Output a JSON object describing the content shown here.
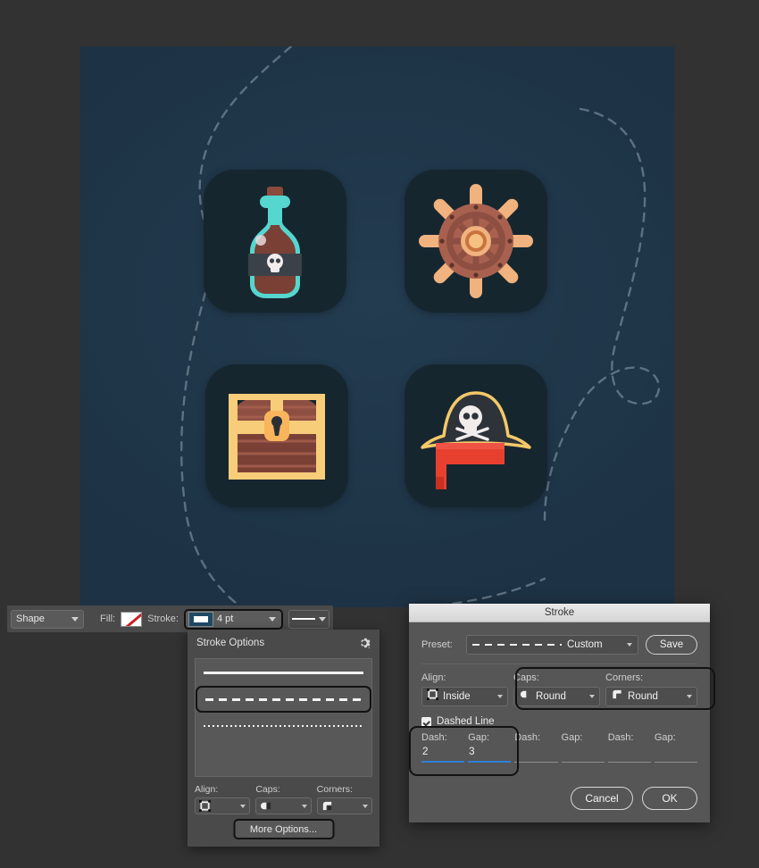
{
  "options_bar": {
    "shape_select": {
      "label": "Shape",
      "icon": "chevron-down-icon"
    },
    "fill_label": "Fill:",
    "fill_swatch": {
      "icon": "no-fill-slash-icon",
      "color": "#cc2222"
    },
    "stroke_label": "Stroke:",
    "stroke_swatch_color": "#1e4a66",
    "stroke_width": "4 pt",
    "stroke_style": "solid-line-preview"
  },
  "stroke_options_panel": {
    "title": "Stroke Options",
    "gear_icon": "gear-icon",
    "presets": [
      {
        "name": "solid",
        "style": "pv-solid",
        "selected": false
      },
      {
        "name": "dashed",
        "style": "pv-dashed",
        "selected": true
      },
      {
        "name": "dotted",
        "style": "pv-dotted",
        "selected": false
      }
    ],
    "align": {
      "label": "Align:",
      "icon": "align-inside-icon"
    },
    "caps": {
      "label": "Caps:",
      "icon": "cap-round-icon"
    },
    "corners": {
      "label": "Corners:",
      "icon": "corner-round-icon"
    },
    "more_options_button": "More Options..."
  },
  "stroke_dialog": {
    "title": "Stroke",
    "preset": {
      "label": "Preset:",
      "value": "Custom",
      "dash_preview": true
    },
    "save_button": "Save",
    "align": {
      "label": "Align:",
      "value": "Inside",
      "icon": "align-inside-icon"
    },
    "caps": {
      "label": "Caps:",
      "value": "Round",
      "icon": "cap-round-icon"
    },
    "corners": {
      "label": "Corners:",
      "value": "Round",
      "icon": "corner-round-icon"
    },
    "dashed_line": {
      "label": "Dashed Line",
      "checked": true
    },
    "dash_gap_fields": [
      {
        "dash_label": "Dash:",
        "dash_value": "2",
        "gap_label": "Gap:",
        "gap_value": "3",
        "active": true
      },
      {
        "dash_label": "Dash:",
        "dash_value": "",
        "gap_label": "Gap:",
        "gap_value": "",
        "active": false
      },
      {
        "dash_label": "Dash:",
        "dash_value": "",
        "gap_label": "Gap:",
        "gap_value": "",
        "active": false
      }
    ],
    "cancel_button": "Cancel",
    "ok_button": "OK",
    "accent_color": "#2f7fd4"
  },
  "canvas": {
    "background_color": "#1d3244",
    "dashed_path_color": "#8fa4b0",
    "tiles": [
      {
        "name": "rum-bottle-icon",
        "position": "top-left"
      },
      {
        "name": "ships-wheel-icon",
        "position": "top-right"
      },
      {
        "name": "treasure-chest-icon",
        "position": "bottom-left"
      },
      {
        "name": "pirate-hat-icon",
        "position": "bottom-right"
      }
    ]
  }
}
